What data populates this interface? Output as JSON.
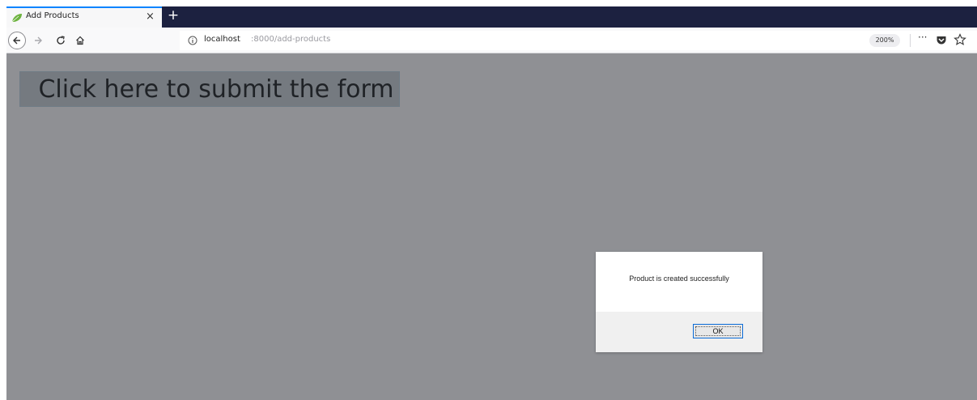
{
  "browser": {
    "tab": {
      "title": "Add Products",
      "close_label": "×",
      "favicon": "leaf-icon"
    },
    "new_tab_label": "+",
    "nav": {
      "back_icon": "back-arrow-icon",
      "forward_icon": "forward-arrow-icon",
      "reload_icon": "reload-icon",
      "home_icon": "home-icon"
    },
    "url": {
      "host": "localhost",
      "path": ":8000/add-products",
      "zoom": "200%",
      "page_actions_label": "···",
      "pocket_icon": "pocket-icon",
      "bookmark_icon": "star-icon"
    },
    "colors": {
      "tabbar": "#1c2140",
      "active_tab_accent": "#0a84ff",
      "content_overlay": "#8f9094"
    }
  },
  "page": {
    "submit_button_label": "Click here to submit the form"
  },
  "alert": {
    "message": "Product is created successfully",
    "ok_label": "OK"
  }
}
